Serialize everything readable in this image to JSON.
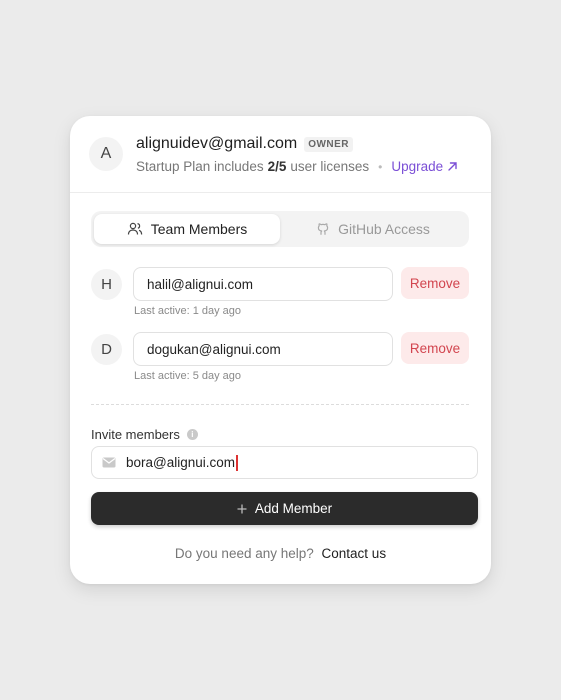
{
  "account": {
    "avatar_initial": "A",
    "email": "alignuidev@gmail.com",
    "role_badge": "OWNER",
    "plan_prefix": "Startup Plan includes",
    "plan_licenses": "2/5",
    "plan_suffix": "user licenses",
    "separator": "•",
    "upgrade_label": "Upgrade",
    "upgrade_icon": "arrow-up-right-icon"
  },
  "tabs": [
    {
      "label": "Team Members",
      "icon": "users-icon",
      "active": true
    },
    {
      "label": "GitHub Access",
      "icon": "github-icon",
      "active": false
    }
  ],
  "members": [
    {
      "initial": "H",
      "email": "halil@alignui.com",
      "last_active": "Last active: 1 day ago",
      "remove_label": "Remove"
    },
    {
      "initial": "D",
      "email": "dogukan@alignui.com",
      "last_active": "Last active: 5 day ago",
      "remove_label": "Remove"
    }
  ],
  "invite": {
    "label": "Invite members",
    "info_icon": "info-icon",
    "mail_icon": "mail-icon",
    "value": "bora@alignui.com",
    "add_label": "Add Member",
    "add_icon": "plus-icon"
  },
  "help": {
    "text": "Do you need any help?",
    "link": "Contact us"
  },
  "colors": {
    "accent": "#7b4fd6",
    "danger": "#d2454f",
    "danger_bg": "#fdeaea",
    "primary_button": "#2b2b2b",
    "background": "#ebebeb"
  }
}
